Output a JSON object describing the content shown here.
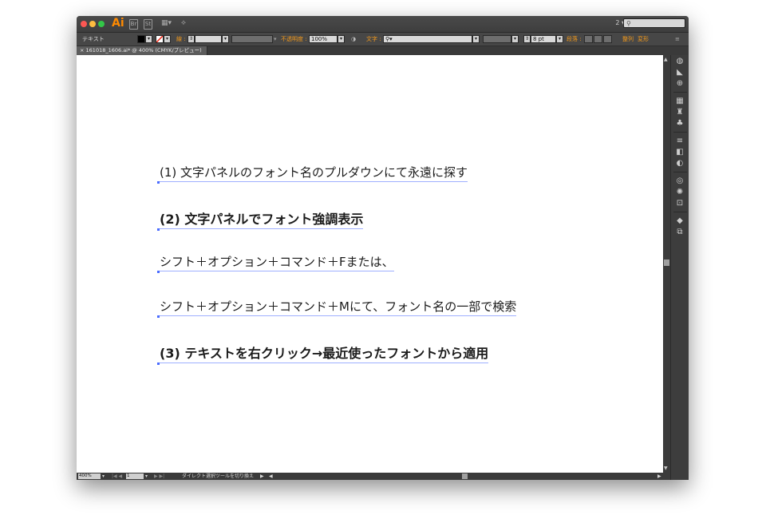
{
  "window": {
    "app_logo": "Ai",
    "workspace_label": "2 ▾",
    "search_icon_text": "⚲",
    "lights": [
      "#fc5753",
      "#fdbc40",
      "#33c748"
    ]
  },
  "control_bar": {
    "object_type": "テキスト",
    "stroke_label": "線 :",
    "opacity_label": "不透明度 :",
    "opacity_value": "100%",
    "character_label": "文字 :",
    "font_search_placeholder": "⚲▾",
    "font_size_value": "8 pt",
    "paragraph_label": "段落 :",
    "align_label": "整列",
    "transform_label": "変形"
  },
  "document_tab": {
    "title": "161018_1606.ai* @ 400% (CMYK/プレビュー)",
    "close": "×"
  },
  "canvas": {
    "lines": [
      "(1) 文字パネルのフォント名のプルダウンにて永遠に探す",
      "(2) 文字パネルでフォント強調表示",
      "シフト＋オプション＋コマンド＋Fまたは、",
      "シフト＋オプション＋コマンド＋Mにて、フォント名の一部で検索",
      "(3) テキストを右クリック→最近使ったフォントから適用"
    ]
  },
  "status_bar": {
    "zoom": "400%",
    "artboard": "1",
    "tool_hint": "ダイレクト選択ツールを切り換え"
  },
  "colors": {
    "accent_orange": "#f39a1c",
    "canvas_bg": "#ffffff",
    "chrome_dark": "#535353"
  }
}
